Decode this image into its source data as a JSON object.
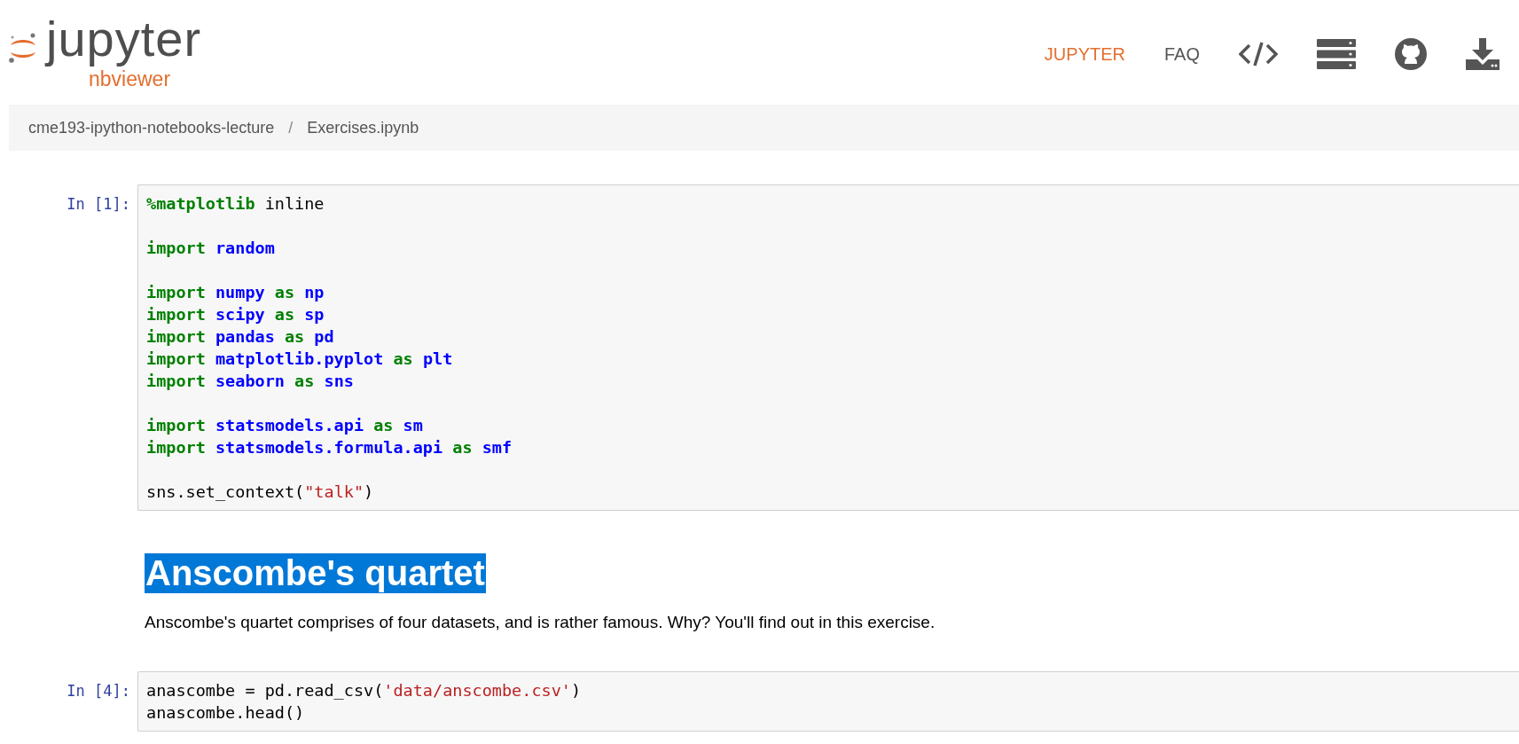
{
  "logo": {
    "name": "jupyter",
    "subtitle": "nbviewer"
  },
  "nav": [
    {
      "kind": "text",
      "label": "JUPYTER",
      "selected": true
    },
    {
      "kind": "text",
      "label": "FAQ",
      "selected": false
    },
    {
      "kind": "code"
    },
    {
      "kind": "server"
    },
    {
      "kind": "github"
    },
    {
      "kind": "download"
    }
  ],
  "breadcrumb": {
    "items": [
      "cme193-ipython-notebooks-lecture",
      "Exercises.ipynb"
    ],
    "separator": "/"
  },
  "cells": [
    {
      "kind": "code",
      "prompt": "In [1]:",
      "lines": [
        {
          "kind": "code",
          "tokens": [
            {
              "magic": "%matplotlib"
            },
            {
              "plain": " inline"
            }
          ]
        },
        {
          "kind": "blank"
        },
        {
          "kind": "code",
          "tokens": [
            {
              "kw": "import "
            },
            {
              "name": "random"
            }
          ]
        },
        {
          "kind": "blank"
        },
        {
          "kind": "code",
          "tokens": [
            {
              "kw": "import "
            },
            {
              "name": "numpy "
            },
            {
              "kw": "as "
            },
            {
              "name": "np"
            }
          ]
        },
        {
          "kind": "code",
          "tokens": [
            {
              "kw": "import "
            },
            {
              "name": "scipy "
            },
            {
              "kw": "as "
            },
            {
              "name": "sp"
            }
          ]
        },
        {
          "kind": "code",
          "tokens": [
            {
              "kw": "import "
            },
            {
              "name": "pandas "
            },
            {
              "kw": "as "
            },
            {
              "name": "pd"
            }
          ]
        },
        {
          "kind": "code",
          "tokens": [
            {
              "kw": "import "
            },
            {
              "name": "matplotlib.pyplot "
            },
            {
              "kw": "as "
            },
            {
              "name": "plt"
            }
          ]
        },
        {
          "kind": "code",
          "tokens": [
            {
              "kw": "import "
            },
            {
              "name": "seaborn "
            },
            {
              "kw": "as "
            },
            {
              "name": "sns"
            }
          ]
        },
        {
          "kind": "blank"
        },
        {
          "kind": "code",
          "tokens": [
            {
              "kw": "import "
            },
            {
              "name": "statsmodels.api "
            },
            {
              "kw": "as "
            },
            {
              "name": "sm"
            }
          ]
        },
        {
          "kind": "code",
          "tokens": [
            {
              "kw": "import "
            },
            {
              "name": "statsmodels.formula.api "
            },
            {
              "kw": "as "
            },
            {
              "name": "smf"
            }
          ]
        },
        {
          "kind": "blank"
        },
        {
          "kind": "code",
          "tokens": [
            {
              "plain": "sns.set_context("
            },
            {
              "str": "\"talk\""
            },
            {
              "plain": ")"
            }
          ]
        }
      ]
    },
    {
      "kind": "markdown",
      "heading": "Anscombe's quartet",
      "highlighted": true,
      "text": "Anscombe's quartet comprises of four datasets, and is rather famous. Why? You'll find out in this exercise."
    },
    {
      "kind": "code",
      "prompt": "In [4]:",
      "lines": [
        {
          "kind": "code",
          "tokens": [
            {
              "plain": "anascombe = pd.read_csv("
            },
            {
              "str": "'data/anscombe.csv'"
            },
            {
              "plain": ")"
            }
          ]
        },
        {
          "kind": "code",
          "tokens": [
            {
              "plain": "anascombe.head()"
            }
          ]
        }
      ]
    }
  ]
}
